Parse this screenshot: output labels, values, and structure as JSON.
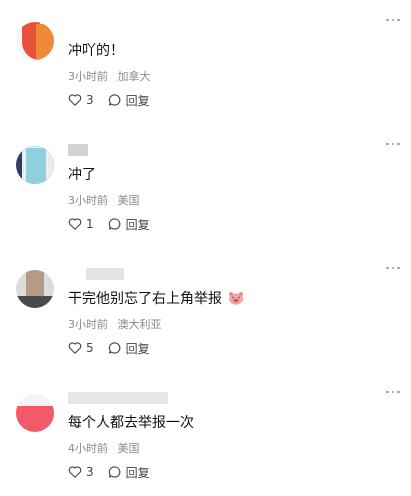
{
  "comments": [
    {
      "text": "冲吖的！",
      "time": "3小时前",
      "location": "加拿大",
      "likes": "3",
      "reply_label": "回复"
    },
    {
      "text": "冲了",
      "time": "3小时前",
      "location": "美国",
      "likes": "1",
      "reply_label": "回复"
    },
    {
      "text": "干完他别忘了右上角举报",
      "time": "3小时前",
      "location": "澳大利亚",
      "likes": "5",
      "reply_label": "回复"
    },
    {
      "text": "每个人都去举报一次",
      "time": "4小时前",
      "location": "美国",
      "likes": "3",
      "reply_label": "回复"
    }
  ],
  "icons": {
    "like": "heart-outline-icon",
    "reply": "speech-bubble-icon",
    "more": "more-dots-icon",
    "emoji": "pig-face-emoji"
  },
  "colors": {
    "meta_text": "#8a8a8a",
    "main_text": "#111111"
  }
}
